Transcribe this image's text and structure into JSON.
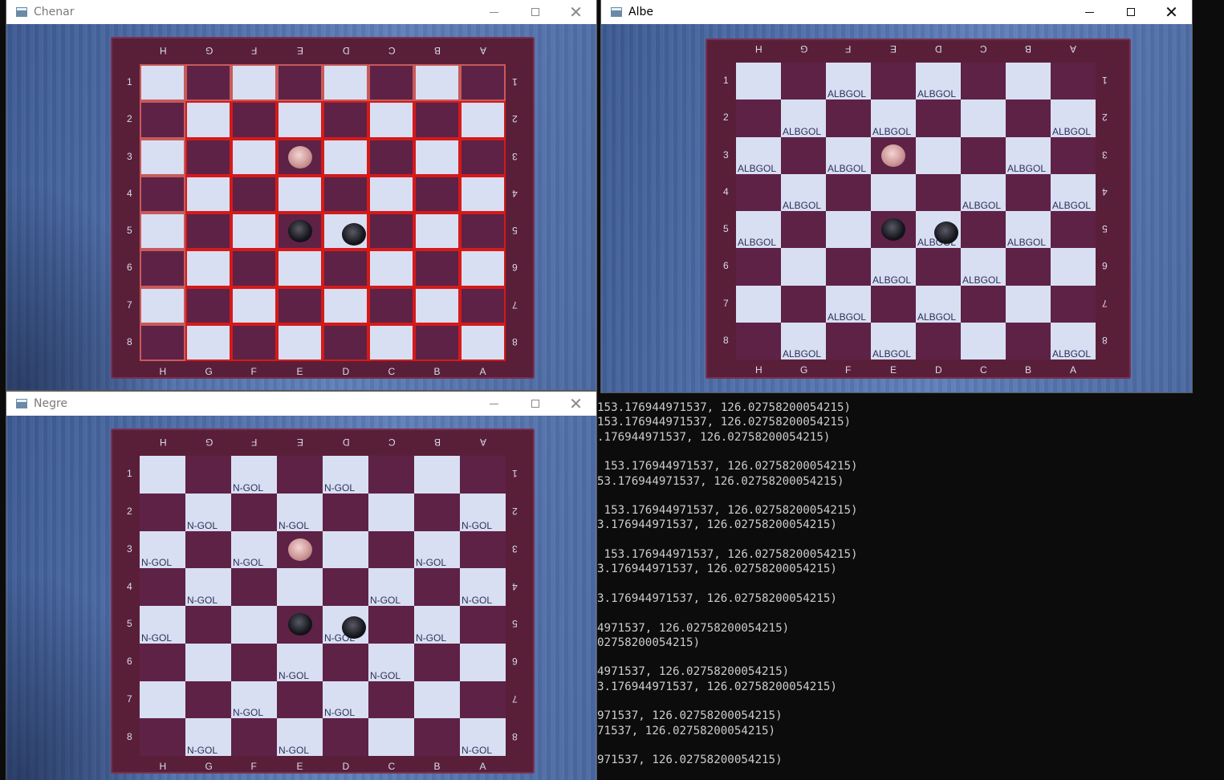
{
  "windows": {
    "chenar": {
      "title": "Chenar"
    },
    "albe": {
      "title": "Albe"
    },
    "negre": {
      "title": "Negre"
    }
  },
  "board": {
    "top_letters": [
      "H",
      "G",
      "F",
      "E",
      "D",
      "C",
      "B",
      "A"
    ],
    "bottom_letters": [
      "H",
      "G",
      "F",
      "E",
      "D",
      "C",
      "B",
      "A"
    ],
    "row_numbers": [
      "1",
      "2",
      "3",
      "4",
      "5",
      "6",
      "7",
      "8"
    ],
    "albe_label": "ALBGOL",
    "negre_label": "N-GOL"
  },
  "console": {
    "lines": [
      "153.176944971537, 126.02758200054215)",
      "153.176944971537, 126.02758200054215)",
      ".176944971537, 126.02758200054215)",
      "",
      " 153.176944971537, 126.02758200054215)",
      "53.176944971537, 126.02758200054215)",
      "",
      " 153.176944971537, 126.02758200054215)",
      "3.176944971537, 126.02758200054215)",
      "",
      " 153.176944971537, 126.02758200054215)",
      "3.176944971537, 126.02758200054215)",
      "",
      "3.176944971537, 126.02758200054215)",
      "",
      "4971537, 126.02758200054215)",
      "02758200054215)",
      "",
      "4971537, 126.02758200054215)",
      "3.176944971537, 126.02758200054215)",
      "",
      "971537, 126.02758200054215)",
      "71537, 126.02758200054215)",
      "",
      "971537, 126.02758200054215)"
    ]
  }
}
